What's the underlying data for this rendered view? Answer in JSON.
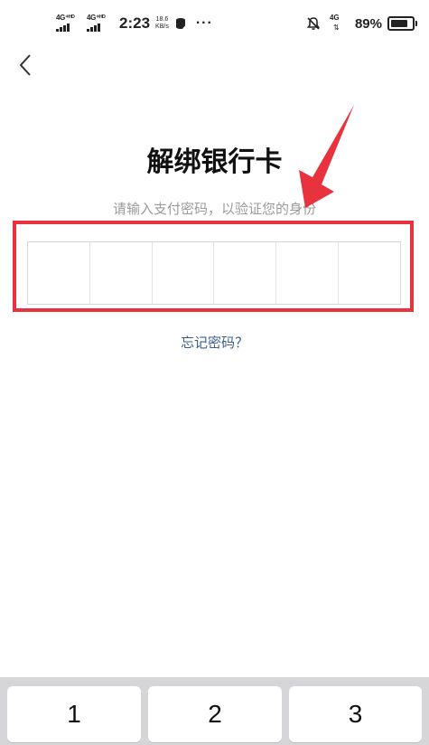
{
  "status_bar": {
    "sim1_label": "4G⁺ᴴᴰ",
    "sim2_label": "4G⁺ᴴᴰ",
    "time": "2:23",
    "speed_value": "18.6",
    "speed_unit": "KB/s",
    "more": "···",
    "network_label": "4G",
    "battery_percent": "89%",
    "battery_level": 0.89
  },
  "header": {
    "back_icon": "chevron-left-icon"
  },
  "main": {
    "title": "解绑银行卡",
    "subtitle": "请输入支付密码，以验证您的身份",
    "pin_length": 6,
    "forgot_password": "忘记密码？"
  },
  "annotation": {
    "box_color": "#e8323d",
    "arrow_color": "#e8323d"
  },
  "keypad": {
    "keys": [
      "1",
      "2",
      "3"
    ]
  }
}
